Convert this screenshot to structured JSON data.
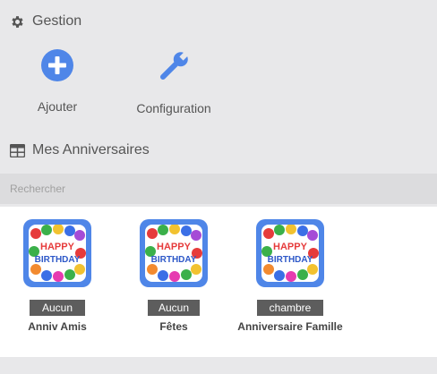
{
  "gestion": {
    "title": "Gestion",
    "title_icon": "gear-icon",
    "actions": [
      {
        "label": "Ajouter",
        "icon": "plus-circle-icon"
      },
      {
        "label": "Configuration",
        "icon": "wrench-icon"
      }
    ]
  },
  "anniversaires": {
    "title": "Mes Anniversaires",
    "title_icon": "table-icon",
    "search": {
      "placeholder": "Rechercher",
      "value": ""
    },
    "items": [
      {
        "name": "Anniv Amis",
        "badge": "Aucun",
        "icon": "happy-birthday-balloons-icon"
      },
      {
        "name": "Fêtes",
        "badge": "Aucun",
        "icon": "happy-birthday-balloons-icon"
      },
      {
        "name": "Anniversaire Famille",
        "badge": "chambre",
        "icon": "happy-birthday-balloons-icon"
      }
    ]
  },
  "colors": {
    "accent": "#4f86e8",
    "badge_bg": "#5d5d5d",
    "background": "#e8e8ea"
  }
}
